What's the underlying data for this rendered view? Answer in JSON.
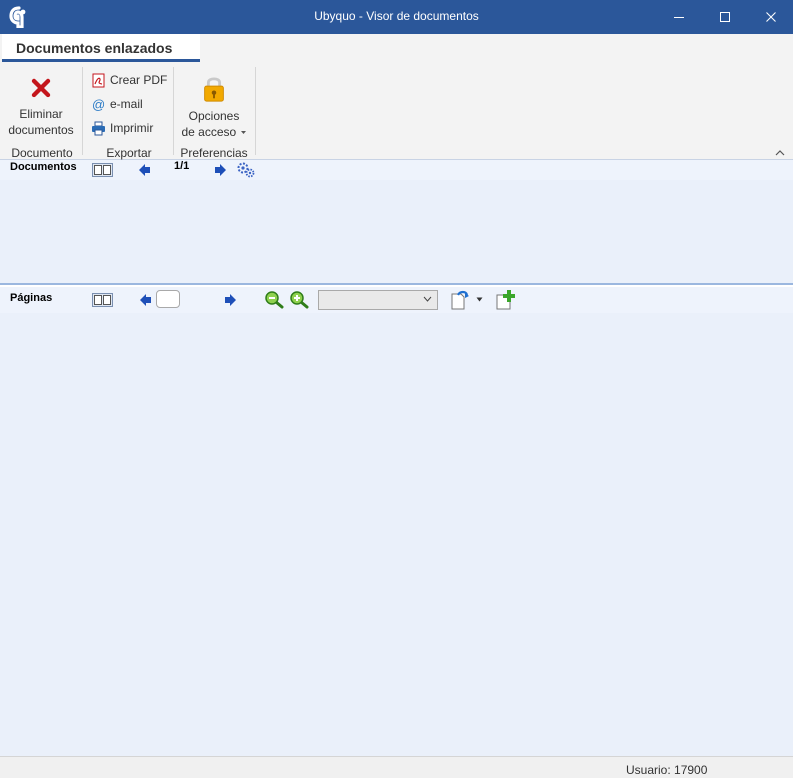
{
  "window": {
    "title": "Ubyquo - Visor de documentos",
    "accent_color": "#2b579a",
    "controls": [
      "minimize-icon",
      "maximize-icon",
      "close-icon"
    ]
  },
  "ribbon": {
    "active_tab": "Documentos enlazados",
    "groups": [
      {
        "label": "Documento",
        "buttons": [
          {
            "icon": "delete-icon",
            "line1": "Eliminar",
            "line2": "documentos"
          }
        ]
      },
      {
        "label": "Exportar",
        "buttons": [
          {
            "icon": "pdf-icon",
            "label": "Crear PDF"
          },
          {
            "icon": "email-icon",
            "label": "e-mail"
          },
          {
            "icon": "printer-icon",
            "label": "Imprimir"
          }
        ]
      },
      {
        "label": "Preferencias",
        "buttons": [
          {
            "icon": "lock-icon",
            "line1": "Opciones",
            "line2": "de acceso",
            "dropdown": true
          }
        ]
      }
    ]
  },
  "documents_pane": {
    "label": "Documentos",
    "page_counter": "1/1"
  },
  "pages_pane": {
    "label": "Páginas",
    "page_input": "",
    "zoom_value": ""
  },
  "status": {
    "user": "Usuario: 17900"
  }
}
